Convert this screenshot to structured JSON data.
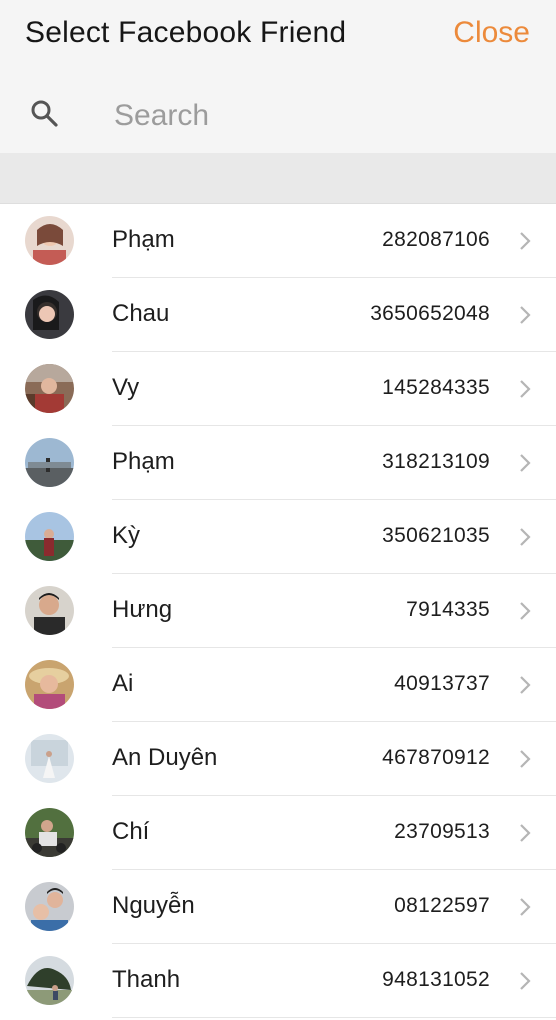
{
  "header": {
    "title": "Select Facebook Friend",
    "close_label": "Close",
    "accent_color": "#ec8a3b"
  },
  "search": {
    "placeholder": "Search",
    "value": "",
    "icon": "search-icon"
  },
  "friends": [
    {
      "name": "Phạm",
      "id": "282087106"
    },
    {
      "name": "Chau",
      "id": "3650652048"
    },
    {
      "name": "Vy",
      "id": "145284335"
    },
    {
      "name": "Phạm",
      "id": "318213109"
    },
    {
      "name": "Kỳ",
      "id": "350621035"
    },
    {
      "name": "Hưng",
      "id": "7914335"
    },
    {
      "name": "Ai",
      "id": "40913737"
    },
    {
      "name": "An Duyên",
      "id": "467870912"
    },
    {
      "name": "Chí",
      "id": "23709513"
    },
    {
      "name": "Nguyễn",
      "id": "08122597"
    },
    {
      "name": "Thanh",
      "id": "948131052"
    }
  ],
  "row_icon": "chevron-right-icon"
}
